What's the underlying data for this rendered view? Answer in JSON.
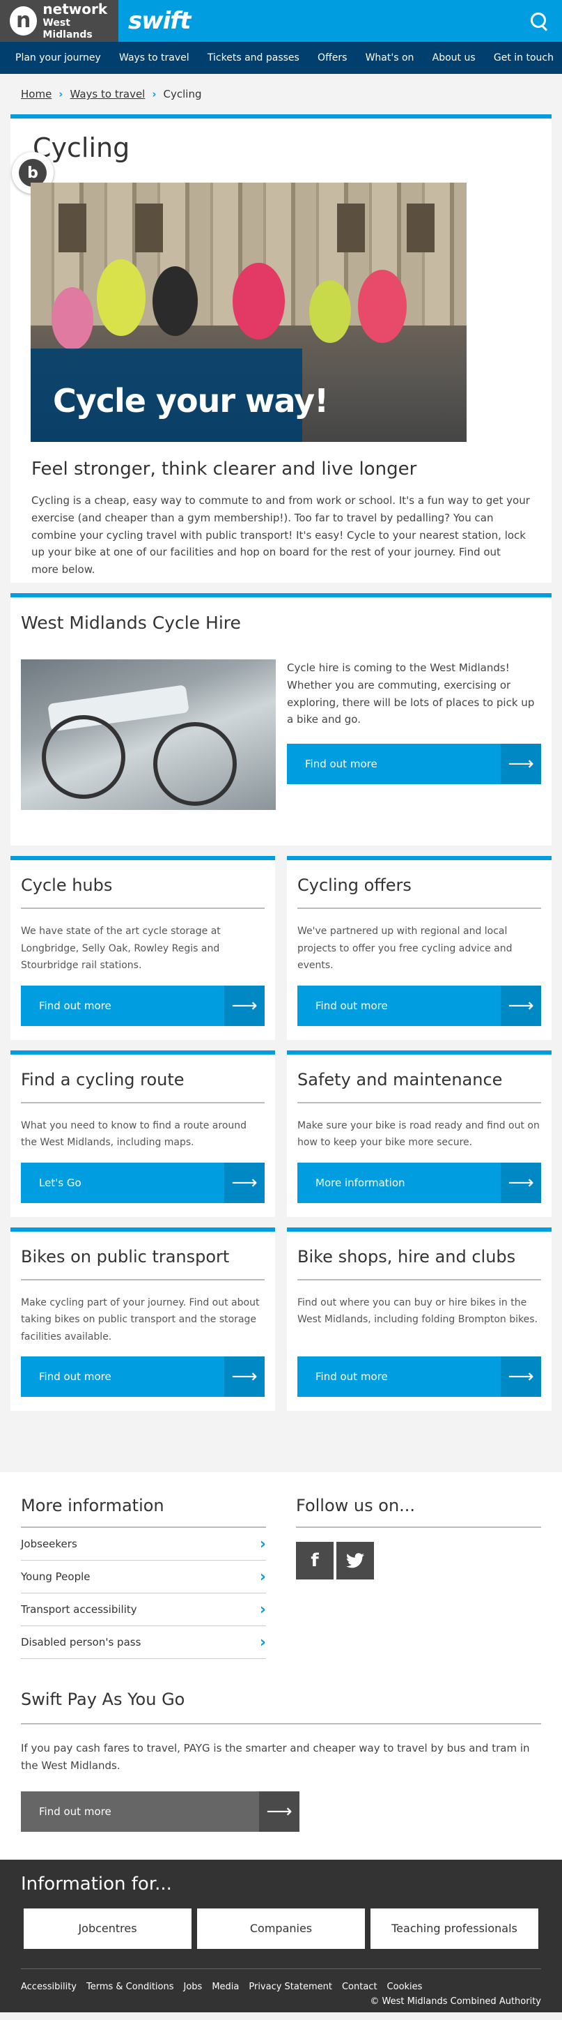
{
  "header": {
    "brand_line1": "network",
    "brand_line2": "West Midlands",
    "brand_mark": "n",
    "swift_logo": "swift",
    "search_icon": "search-icon"
  },
  "nav": [
    "Plan your journey",
    "Ways to travel",
    "Tickets and passes",
    "Offers",
    "What's on",
    "About us",
    "Get in touch"
  ],
  "breadcrumb": {
    "home": "Home",
    "ways": "Ways to travel",
    "current": "Cycling"
  },
  "intro": {
    "title": "Cycling",
    "avatar_letter": "b",
    "hero_caption": "Cycle your way!",
    "subtitle": "Feel stronger, think clearer and live longer",
    "body": "Cycling is a cheap, easy way to commute to and from work or school. It's a fun way to get your exercise (and cheaper than a gym membership!). Too far to travel by pedalling? You can combine your cycling travel with public transport! It's easy! Cycle to your nearest station, lock up your bike at one of our facilities and hop on board for the rest of your journey. Find out more below."
  },
  "hire": {
    "title": "West Midlands Cycle Hire",
    "body": "Cycle hire is coming to the West Midlands! Whether you are commuting, exercising or exploring, there will be lots of places to pick up a bike and go.",
    "button": "Find out more"
  },
  "tiles": [
    {
      "title": "Cycle hubs",
      "body": "We have state of the art cycle storage at Longbridge, Selly Oak, Rowley Regis and Stourbridge rail stations.",
      "button": "Find out more"
    },
    {
      "title": "Cycling offers",
      "body": "We've partnered up with regional and local projects to offer you free cycling advice and events.",
      "button": "Find out more"
    },
    {
      "title": "Find a cycling route",
      "body": "What you need to know to find a route around the West Midlands, including maps.",
      "button": "Let's Go"
    },
    {
      "title": "Safety and maintenance",
      "body": "Make sure your bike is road ready and find out on how to keep your bike more secure.",
      "button": "More information"
    },
    {
      "title": "Bikes on public transport",
      "body": "Make cycling part of your journey. Find out about taking bikes on public transport and the storage facilities available.",
      "button": "Find out more"
    },
    {
      "title": "Bike shops, hire and clubs",
      "body": "Find out where you can buy or hire bikes in the West Midlands, including folding Brompton bikes.",
      "button": "Find out more"
    }
  ],
  "more_info": {
    "title": "More information",
    "links": [
      "Jobseekers",
      "Young People",
      "Transport accessibility",
      "Disabled person's pass"
    ]
  },
  "follow": {
    "title": "Follow us on...",
    "facebook": "f",
    "twitter": "t"
  },
  "payg": {
    "title": "Swift Pay As You Go",
    "body": "If you pay cash fares to travel, PAYG is the smarter and cheaper way to travel by bus and tram in the West Midlands.",
    "button": "Find out more"
  },
  "info_for": {
    "title": "Information for...",
    "links": [
      "Jobcentres",
      "Companies",
      "Teaching professionals"
    ]
  },
  "footer": {
    "links": [
      "Accessibility",
      "Terms & Conditions",
      "Jobs",
      "Media",
      "Privacy Statement",
      "Contact",
      "Cookies"
    ],
    "copyright": "© West Midlands Combined Authority"
  },
  "colors": {
    "accent": "#009ee0",
    "nav": "#003f6e",
    "dark": "#333333"
  }
}
